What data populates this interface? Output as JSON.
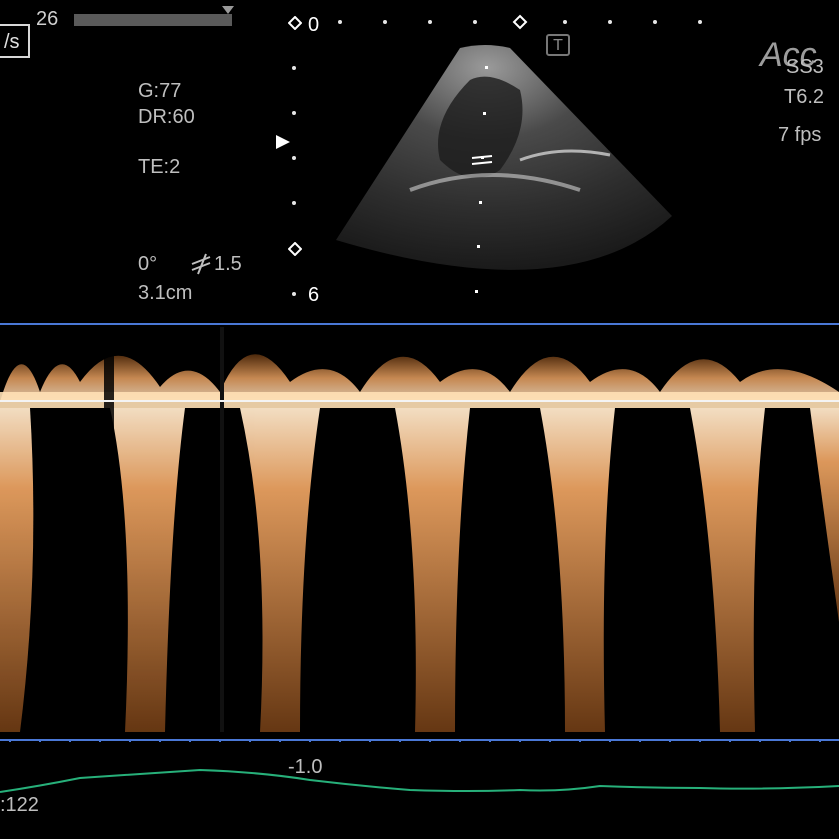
{
  "header": {
    "unit_label": "/s",
    "frame_number": "26",
    "progress": 0.95,
    "depth_top": "0",
    "depth_bottom": "6",
    "logo_text": "Acc",
    "trans_badge": "T"
  },
  "settings_left": {
    "gain": "G:77",
    "dynamic_range": "DR:60",
    "te": "TE:2",
    "angle": "0°",
    "filter": "1.5",
    "sample_depth": "3.1cm"
  },
  "settings_right": {
    "probe_partial": "SS3",
    "t_value": "T6.2",
    "fps": "7 fps"
  },
  "spectral": {
    "scale_label": "-1.0",
    "heart_rate": ":122"
  },
  "colors": {
    "baseline_blue": "#4a78d6",
    "doppler_orange": "#e8a060",
    "ecg_green": "#27b07a"
  },
  "icons": [
    "play-marker-icon",
    "focus-diamond-icon",
    "filter-icon"
  ]
}
